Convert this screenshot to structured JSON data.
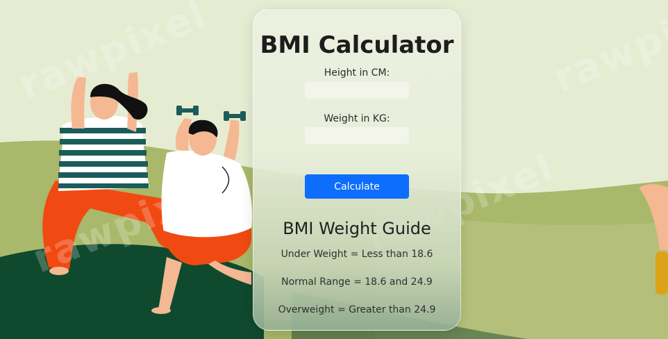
{
  "watermark": "rawpixel",
  "calculator": {
    "title": "BMI Calculator",
    "height_label": "Height in CM:",
    "height_value": "",
    "weight_label": "Weight in KG:",
    "weight_value": "",
    "calculate_label": "Calculate"
  },
  "guide": {
    "title": "BMI Weight Guide",
    "items": [
      "Under Weight = Less than 18.6",
      "Normal Range = 18.6 and 24.9",
      "Overweight = Greater than 24.9"
    ]
  },
  "colors": {
    "button": "#0d6efd",
    "background": "#e6ecd2",
    "hill": "#a9b86a",
    "dark_ground": "#0f4a2e",
    "pants": "#f04a12",
    "stripes": "#1b5c5a",
    "skin": "#f4b892"
  }
}
